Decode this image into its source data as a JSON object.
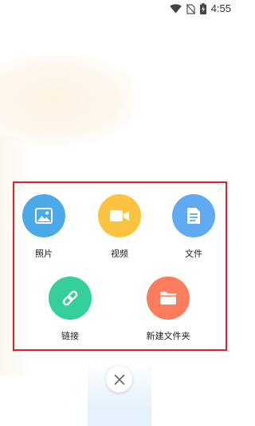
{
  "status_bar": {
    "time": "4:55",
    "icons": [
      "wifi-icon",
      "no-sim-icon",
      "battery-charging-icon"
    ]
  },
  "actions": [
    {
      "id": "photo",
      "label": "照片",
      "icon": "image-icon",
      "color": "#4aa9e6"
    },
    {
      "id": "video",
      "label": "视频",
      "icon": "video-camera-icon",
      "color": "#fcc340"
    },
    {
      "id": "file",
      "label": "文件",
      "icon": "document-icon",
      "color": "#60aaf4"
    },
    {
      "id": "link",
      "label": "链接",
      "icon": "link-icon",
      "color": "#35cf9c"
    },
    {
      "id": "new_folder",
      "label": "新建文件夹",
      "icon": "folder-icon",
      "color": "#fb7d5e"
    }
  ],
  "highlight_color": "#d4262b",
  "close_icon": "close-icon"
}
